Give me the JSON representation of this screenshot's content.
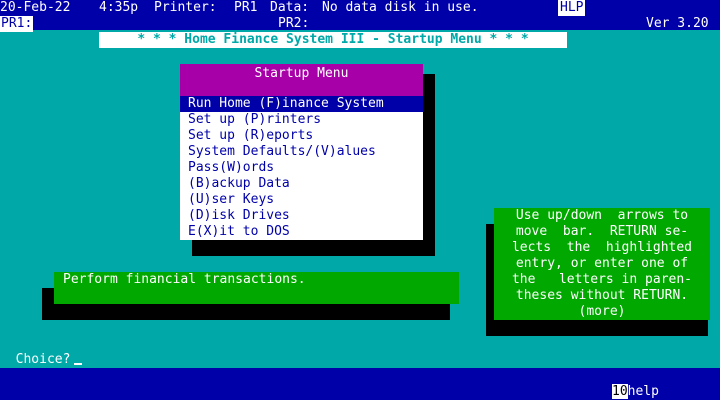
{
  "status_bar": {
    "date": "20-Feb-22",
    "time": "4:35p",
    "printer_label": "Printer:",
    "printer_value": "PR1",
    "data_label": "Data:",
    "data_value": "No data disk in use.",
    "help_key": "HLP",
    "pr1": "PR1:",
    "pr2": "PR2:",
    "version": "Ver 3.20"
  },
  "banner": {
    "title": "* * * Home Finance System III - Startup Menu * * *"
  },
  "menu": {
    "title": "Startup Menu",
    "items": [
      {
        "label": "Run Home (F)inance System"
      },
      {
        "label": "Set up (P)rinters"
      },
      {
        "label": "Set up (R)eports"
      },
      {
        "label": "System Defaults/(V)alues"
      },
      {
        "label": "Pass(W)ords"
      },
      {
        "label": "(B)ackup Data"
      },
      {
        "label": "(U)ser Keys"
      },
      {
        "label": "(D)isk Drives"
      },
      {
        "label": "E(X)it to DOS"
      }
    ],
    "selected_index": 0
  },
  "description": {
    "text": "Perform financial transactions."
  },
  "help_box": {
    "lines": [
      "Use up/down  arrows to",
      "move  bar.  RETURN se-",
      "lects  the  highlighted",
      "entry, or enter one of",
      "the   letters in paren-",
      "theses without RETURN.",
      "(more)"
    ]
  },
  "prompt": {
    "label": "Choice?"
  },
  "footer": {
    "fkey": "10",
    "fkey_label": "help"
  },
  "colors": {
    "background": "#00a8a8",
    "bar": "#0000a8",
    "menu_header": "#a800a8",
    "panel_green": "#00a800"
  }
}
